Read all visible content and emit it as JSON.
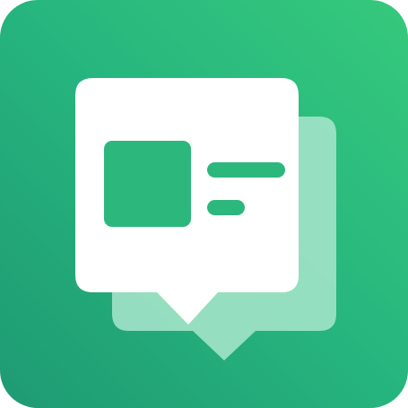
{
  "app_icon": {
    "icon": "chat-message-icon",
    "colors": {
      "gradient_start": "#27B77F",
      "gradient_end": "#1F9A73",
      "gradient_highlight": "#35C97B",
      "front_bubble": "#FFFFFF",
      "back_bubble": "#A9E6CC",
      "content_accent": "#2CB77C"
    }
  }
}
